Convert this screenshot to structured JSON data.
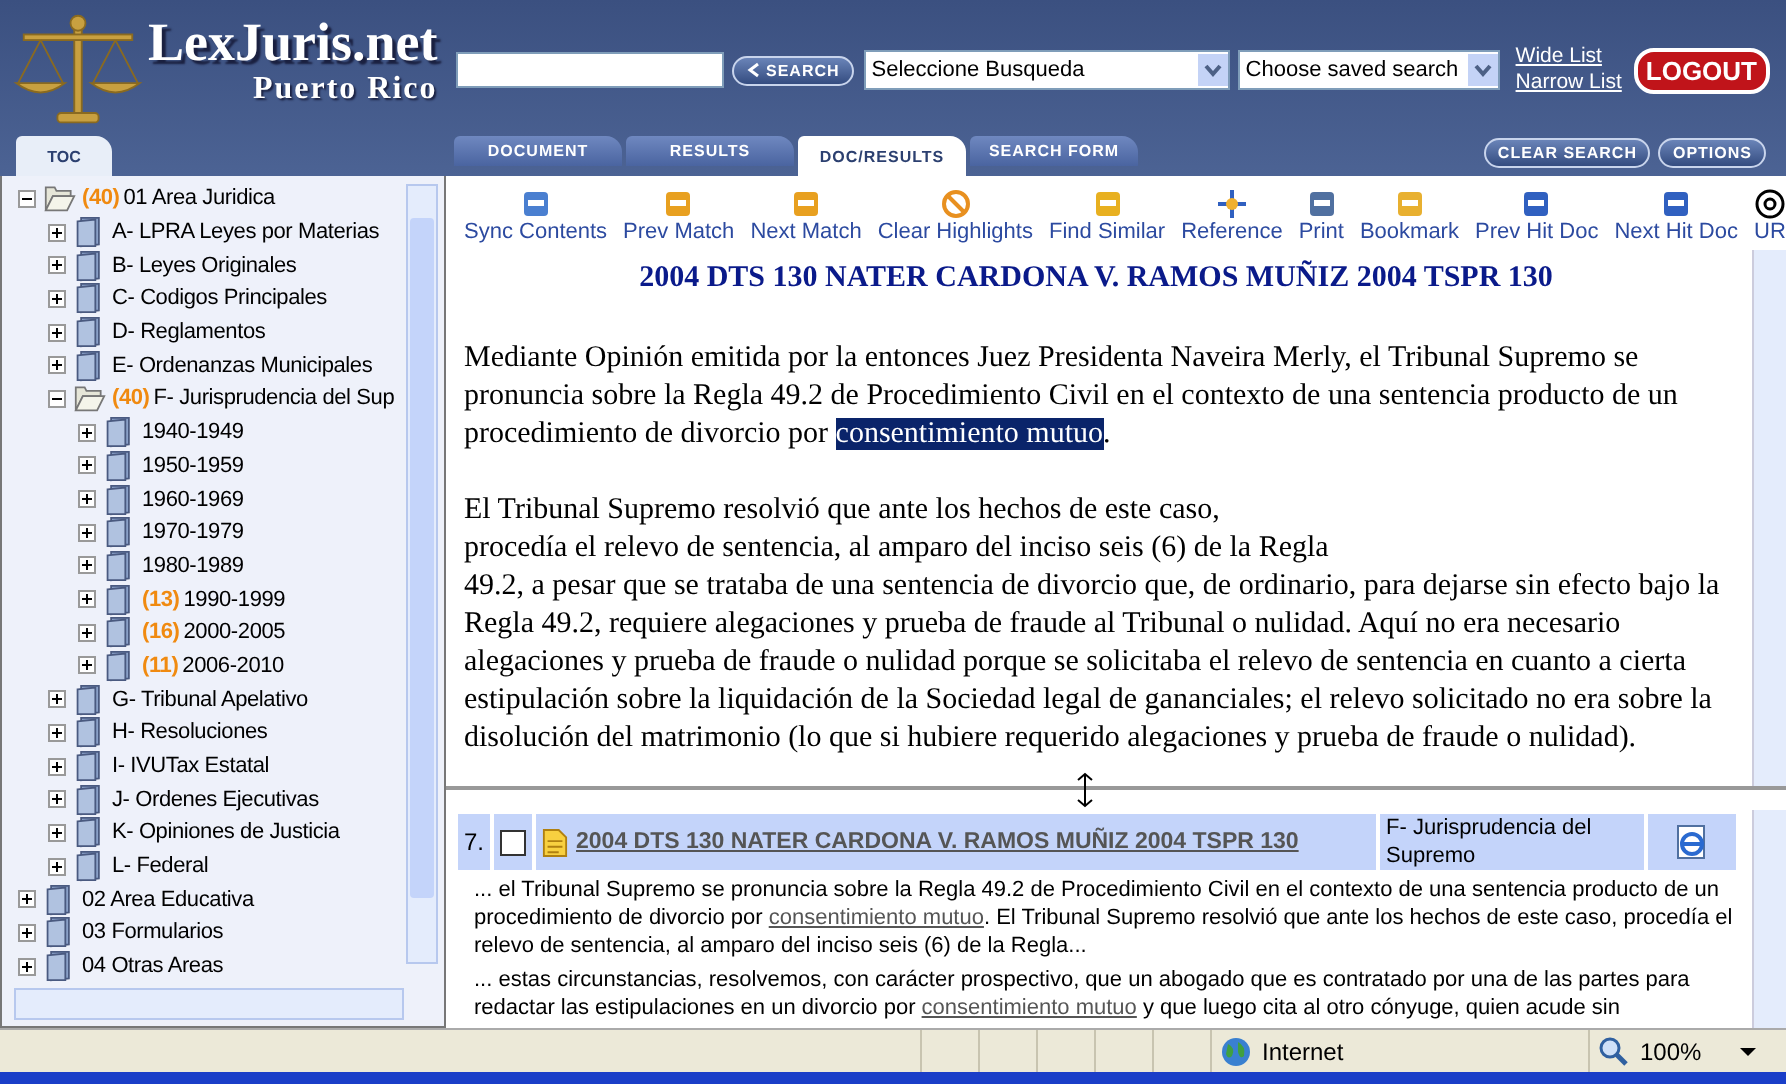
{
  "header": {
    "logo_title": "LexJuris.net",
    "logo_subtitle": "Puerto Rico",
    "search_button": "SEARCH",
    "search_select": "Seleccione Busqueda",
    "saved_select": "Choose saved search",
    "links": [
      "Wide List",
      "Narrow List"
    ],
    "logout": "LOGOUT"
  },
  "toc_tab": "TOC",
  "tabs": [
    {
      "label": "DOCUMENT",
      "selected": false
    },
    {
      "label": "RESULTS",
      "selected": false
    },
    {
      "label": "DOC/RESULTS",
      "selected": true
    },
    {
      "label": "SEARCH FORM",
      "selected": false
    }
  ],
  "tab_buttons": [
    "CLEAR SEARCH",
    "OPTIONS"
  ],
  "tree": [
    {
      "label": "01 Area Juridica",
      "count": "(40)",
      "expanded": true,
      "children": [
        {
          "label": "A- LPRA Leyes por Materias",
          "expanded": false
        },
        {
          "label": "B- Leyes Originales",
          "expanded": false
        },
        {
          "label": "C- Codigos Principales",
          "expanded": false
        },
        {
          "label": "D- Reglamentos",
          "expanded": false
        },
        {
          "label": "E- Ordenanzas Municipales",
          "expanded": false
        },
        {
          "label": "F- Jurisprudencia del Sup",
          "count": "(40)",
          "expanded": true,
          "children": [
            {
              "label": "1940-1949",
              "expanded": false
            },
            {
              "label": "1950-1959",
              "expanded": false
            },
            {
              "label": "1960-1969",
              "expanded": false
            },
            {
              "label": "1970-1979",
              "expanded": false
            },
            {
              "label": "1980-1989",
              "expanded": false
            },
            {
              "label": "1990-1999",
              "count": "(13)",
              "expanded": false
            },
            {
              "label": "2000-2005",
              "count": "(16)",
              "expanded": false
            },
            {
              "label": "2006-2010",
              "count": "(11)",
              "expanded": false
            }
          ]
        },
        {
          "label": "G- Tribunal Apelativo",
          "expanded": false
        },
        {
          "label": "H- Resoluciones",
          "expanded": false
        },
        {
          "label": "I- IVUTax Estatal",
          "expanded": false
        },
        {
          "label": "J- Ordenes Ejecutivas",
          "expanded": false
        },
        {
          "label": "K- Opiniones de Justicia",
          "expanded": false
        },
        {
          "label": "L- Federal",
          "expanded": false
        }
      ]
    },
    {
      "label": "02 Area Educativa",
      "expanded": false
    },
    {
      "label": "03 Formularios",
      "expanded": false
    },
    {
      "label": "04 Otras Areas",
      "expanded": false
    }
  ],
  "toolbar": [
    "Sync Contents",
    "Prev Match",
    "Next Match",
    "Clear Highlights",
    "Find Similar",
    "Reference",
    "Print",
    "Bookmark",
    "Prev Hit Doc",
    "Next Hit Doc",
    "UR"
  ],
  "document": {
    "title": "2004 DTS 130 NATER CARDONA V. RAMOS MUÑIZ 2004 TSPR 130",
    "paragraph_1": {
      "before": "Mediante Opinión emitida por la entonces Juez Presidenta Naveira Merly, el Tribunal Supremo se pronuncia sobre la Regla 49.2 de Procedimiento Civil en el contexto de una sentencia producto de un procedimiento de divorcio por ",
      "highlight": "consentimiento mutuo",
      "after": "."
    },
    "paragraph_2": [
      "El Tribunal Supremo resolvió que ante los hechos de este caso,",
      "procedía el relevo de sentencia, al amparo del inciso seis (6) de la Regla",
      "49.2, a pesar que se trataba de una sentencia de divorcio que, de ordinario, para dejarse sin efecto bajo la Regla 49.2, requiere alegaciones y prueba de fraude al Tribunal o nulidad.  Aquí no era necesario alegaciones y prueba de fraude o nulidad porque se solicitaba el relevo de sentencia en cuanto a  cierta estipulación sobre la liquidación de la Sociedad legal de gananciales; el relevo solicitado no era sobre la disolución del matrimonio (lo que si hubiere requerido alegaciones  y prueba de fraude o nulidad)."
    ]
  },
  "result": {
    "number": "7.",
    "checked": false,
    "title": "2004 DTS 130 NATER CARDONA V. RAMOS MUÑIZ 2004 TSPR 130",
    "category": "F- Jurisprudencia del Supremo",
    "snippets": [
      [
        {
          "text": "... el Tribunal Supremo se pronuncia sobre la Regla 49.2 de Procedimiento Civil en el contexto de una sentencia producto de un procedimiento de divorcio por ",
          "link": false
        },
        {
          "text": "consentimiento mutuo",
          "link": true
        },
        {
          "text": ". El Tribunal Supremo resolvió que ante los hechos de este caso, procedía el relevo de sentencia, al amparo del inciso seis (6) de la Regla...",
          "link": false
        }
      ],
      [
        {
          "text": "... estas circunstancias, resolvemos, con carácter prospectivo, que un abogado que es contratado por una de las partes para redactar las estipulaciones en un divorcio por ",
          "link": false
        },
        {
          "text": "consentimiento mutuo",
          "link": true
        },
        {
          "text": " y que luego cita al otro cónyuge, quien acude sin",
          "link": false
        }
      ]
    ]
  },
  "status_bar": {
    "zone": "Internet",
    "zoom": "100%"
  }
}
